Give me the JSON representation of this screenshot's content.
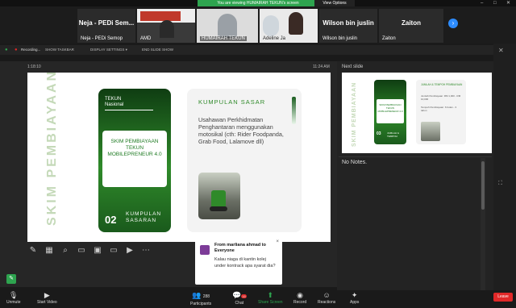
{
  "top": {
    "banner": "You are viewing HUMAIRAH TEKUN's screen",
    "view_options": "View Options",
    "min": "–",
    "max": "□",
    "close": "✕"
  },
  "thumbnails": [
    {
      "name": "Neja - PEDi Semop",
      "big": "Neja - PEDi Sem..."
    },
    {
      "name": "AMD",
      "big": ""
    },
    {
      "name": "HUMAIRAH TEKUN",
      "big": ""
    },
    {
      "name": "Adeline Ja",
      "big": ""
    },
    {
      "name": "Wilson bin juslin",
      "big": "Wilson bin juslin"
    },
    {
      "name": "Zaiton",
      "big": "Zaiton"
    }
  ],
  "toolbar_row": {
    "recording": "Recording...",
    "show_taskbar": "SHOW TASKBAR",
    "display_settings": "DISPLAY SETTINGS ▾",
    "end_slide_show": "END SLIDE SHOW"
  },
  "presenter": {
    "elapsed": "1:18:10",
    "clock": "11:24 AM",
    "next_slide_label": "Next slide",
    "notes": "No Notes."
  },
  "slide": {
    "vertical_title": "SKIM PEMBIAYAAN",
    "card1_header_line1": "TEKUN",
    "card1_header_line2": "Nasional",
    "card1_body": "SKIM PEMBIAYAAN TEKUN MOBILEPRENEUR 4.0",
    "card1_number": "02",
    "card1_footer_line1": "KUMPULAN",
    "card1_footer_line2": "SASARAN",
    "card2_title": "KUMPULAN SASAR",
    "card2_desc": "Usahawan Perkhidmatan Penghantaran menggunakan motosikal (cth: Rider Foodpanda, Grab Food, Lalamove dll)"
  },
  "mini_slide": {
    "vertical_title": "SKIM PEMBIAYAAN",
    "card1_body": "SKIM PEMBIAYAAN TEKUN MOBILEPRENEUR 4.0",
    "card1_number": "03",
    "card1_footer": "JUMLAH & TEMPOH",
    "card2_title": "JUMLAH & TEMPOH PEMBIAYAAN",
    "card2_desc1": "Jumlah Pembiayaan: RM 1,000 - RM 10,000",
    "card2_desc2": "Tempoh Pembiayaan: 6 bulan - 3 tahun"
  },
  "chat": {
    "from": "From marliana ahmad to Everyone",
    "message": "Kalau niaga di kantin kolej under kontrack apa syarat dia?",
    "close": "×"
  },
  "bottom": {
    "unmute": "Unmute",
    "start_video": "Start Video",
    "participants": "Participants",
    "participants_count": "288",
    "chat": "Chat",
    "chat_count": "16",
    "share_screen": "Share Screen",
    "record": "Record",
    "reactions": "Reactions",
    "apps": "Apps",
    "leave": "Leave"
  },
  "colors": {
    "accent_green": "#2f8a2a",
    "banner_green": "#2ea44f",
    "leave_red": "#e02828",
    "zoom_blue": "#2d8cff"
  }
}
